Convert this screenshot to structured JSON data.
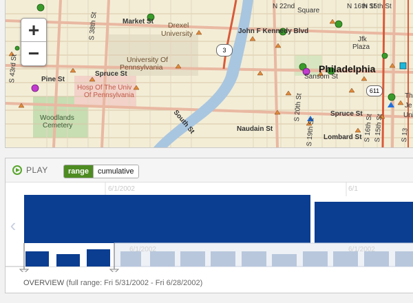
{
  "map": {
    "city_label": "Philadelphia",
    "street_labels": [
      "Market St",
      "Drexel",
      "University",
      "John F Kennedy Blvd",
      "N 22nd",
      "N 16th St",
      "N 15th St",
      "Square",
      "Jfk",
      "Plaza",
      "University Of",
      "Pennsylvania",
      "Spruce St",
      "S 38th St",
      "S 43rd St",
      "Pine St",
      "Hosp Of The Univ",
      "Of Pennsylvania",
      "Woodlands",
      "Cemetery",
      "South St",
      "Sansom St",
      "Spruce St",
      "S 20th St",
      "S 19th St",
      "Naudain St",
      "Lombard St",
      "S 15th St",
      "S 16th St",
      "S 13",
      "The",
      "Je",
      "Uni"
    ],
    "route_badges": [
      "3",
      "611"
    ],
    "zoom_in_label": "+",
    "zoom_out_label": "−",
    "colors": {
      "green": "#3a9b2a",
      "magenta": "#c23ad0",
      "blue": "#1e6fe0",
      "cyan": "#1fb7d9",
      "triangle_orange": "#e08a3b"
    }
  },
  "timeline": {
    "play_label": "PLAY",
    "mode_buttons": [
      "range",
      "cumulative"
    ],
    "selected_mode": "range",
    "top_date_labels": [
      "6/1/2002",
      "6/1"
    ],
    "overview_date_labels": [
      "6/1/2002",
      "6/1/2002"
    ],
    "overview_text": "OVERVIEW",
    "overview_range": "(full range: Fri 5/31/2002 - Fri 6/28/2002)",
    "colors": {
      "bar": "#0b3d91",
      "bar_dim": "#b8c7dc"
    }
  }
}
